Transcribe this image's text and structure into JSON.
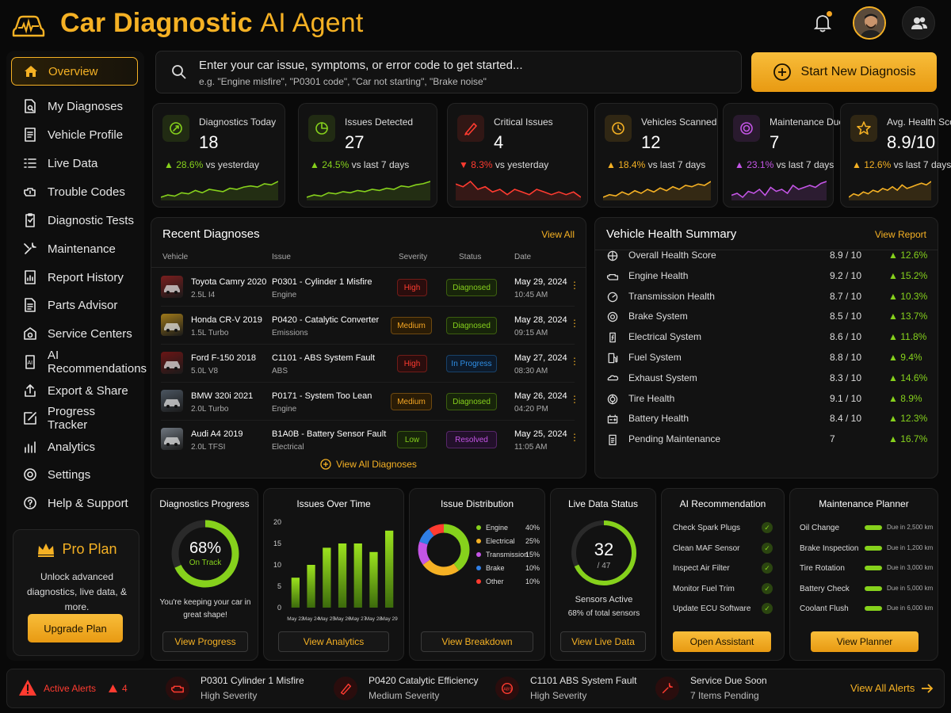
{
  "header": {
    "title_bold": "Car Diagnostic",
    "title_light": "AI Agent"
  },
  "sidebar": {
    "items": [
      {
        "label": "Overview",
        "icon": "home-icon",
        "active": true
      },
      {
        "label": "My Diagnoses",
        "icon": "document-search-icon"
      },
      {
        "label": "Vehicle Profile",
        "icon": "vehicle-profile-icon"
      },
      {
        "label": "Live Data",
        "icon": "list-icon"
      },
      {
        "label": "Trouble Codes",
        "icon": "engine-warning-icon"
      },
      {
        "label": "Diagnostic Tests",
        "icon": "test-clipboard-icon"
      },
      {
        "label": "Maintenance",
        "icon": "wrench-icon"
      },
      {
        "label": "Report History",
        "icon": "report-icon"
      },
      {
        "label": "Parts Advisor",
        "icon": "document-icon"
      },
      {
        "label": "Service Centers",
        "icon": "service-center-icon"
      },
      {
        "label": "AI Recommendations",
        "icon": "ai-icon"
      },
      {
        "label": "Export & Share",
        "icon": "share-icon"
      },
      {
        "label": "Progress Tracker",
        "icon": "edit-icon"
      },
      {
        "label": "Analytics",
        "icon": "analytics-icon"
      },
      {
        "label": "Settings",
        "icon": "gear-icon"
      },
      {
        "label": "Help & Support",
        "icon": "help-icon"
      }
    ],
    "pro": {
      "title": "Pro Plan",
      "text": "Unlock advanced diagnostics, live data, & more.",
      "button": "Upgrade Plan"
    }
  },
  "search": {
    "title": "Enter your car issue, symptoms, or error code to get started...",
    "example": "e.g. \"Engine misfire\", \"P0301 code\", \"Car not starting\", \"Brake noise\""
  },
  "start_button": "Start New Diagnosis",
  "stats": [
    {
      "label": "Diagnostics Today",
      "value": "18",
      "change": "28.6%",
      "dir": "up",
      "period": "vs yesterday",
      "color": "#86d11c",
      "icon": "diagnostics-icon"
    },
    {
      "label": "Issues Detected",
      "value": "27",
      "change": "24.5%",
      "dir": "up",
      "period": "vs last 7 days",
      "color": "#86d11c",
      "icon": "pie-icon"
    },
    {
      "label": "Critical Issues",
      "value": "4",
      "change": "8.3%",
      "dir": "down",
      "period": "vs yesterday",
      "color": "#ff3b30",
      "icon": "critical-icon"
    },
    {
      "label": "Vehicles Scanned",
      "value": "12",
      "change": "18.4%",
      "dir": "up",
      "period": "vs last 7 days",
      "color": "#f5b124",
      "icon": "clock-icon"
    },
    {
      "label": "Maintenance Due",
      "value": "7",
      "change": "23.1%",
      "dir": "up",
      "period": "vs last 7 days",
      "color": "#c455e6",
      "icon": "maintenance-icon"
    },
    {
      "label": "Avg. Health Score",
      "value": "8.9/10",
      "change": "12.6%",
      "dir": "up",
      "period": "vs last 7 days",
      "color": "#f5b124",
      "icon": "star-icon"
    }
  ],
  "recent": {
    "title": "Recent Diagnoses",
    "link": "View All",
    "headers": {
      "vehicle": "Vehicle",
      "issue": "Issue",
      "severity": "Severity",
      "status": "Status",
      "date": "Date"
    },
    "rows": [
      {
        "car": "Toyota Camry 2020",
        "engine": "2.5L I4",
        "code": "P0301 - Cylinder 1 Misfire",
        "system": "Engine",
        "severity": "High",
        "status": "Diagnosed",
        "date": "May 29, 2024",
        "time": "10:45 AM",
        "thumb": "#7a1e1e"
      },
      {
        "car": "Honda CR-V 2019",
        "engine": "1.5L Turbo",
        "code": "P0420 - Catalytic Converter",
        "system": "Emissions",
        "severity": "Medium",
        "status": "Diagnosed",
        "date": "May 28, 2024",
        "time": "09:15 AM",
        "thumb": "#a07a1a"
      },
      {
        "car": "Ford F-150 2018",
        "engine": "5.0L V8",
        "code": "C1101 - ABS System Fault",
        "system": "ABS",
        "severity": "High",
        "status": "In Progress",
        "date": "May 27, 2024",
        "time": "08:30 AM",
        "thumb": "#6a1515"
      },
      {
        "car": "BMW 320i 2021",
        "engine": "2.0L Turbo",
        "code": "P0171 - System Too Lean",
        "system": "Engine",
        "severity": "Medium",
        "status": "Diagnosed",
        "date": "May 26, 2024",
        "time": "04:20 PM",
        "thumb": "#4b5560"
      },
      {
        "car": "Audi A4 2019",
        "engine": "2.0L TFSI",
        "code": "B1A0B - Battery Sensor Fault",
        "system": "Electrical",
        "severity": "Low",
        "status": "Resolved",
        "date": "May 25, 2024",
        "time": "11:05 AM",
        "thumb": "#6f7780"
      }
    ],
    "footer": "View All Diagnoses"
  },
  "health": {
    "title": "Vehicle Health Summary",
    "link": "View Report",
    "rows": [
      {
        "label": "Overall Health Score",
        "score": "8.9 / 10",
        "change": "12.6%",
        "icon": "overall-health-icon"
      },
      {
        "label": "Engine Health",
        "score": "9.2 / 10",
        "change": "15.2%",
        "icon": "engine-icon"
      },
      {
        "label": "Transmission Health",
        "score": "8.7 / 10",
        "change": "10.3%",
        "icon": "transmission-icon"
      },
      {
        "label": "Brake System",
        "score": "8.5 / 10",
        "change": "13.7%",
        "icon": "brake-icon"
      },
      {
        "label": "Electrical System",
        "score": "8.6 / 10",
        "change": "11.8%",
        "icon": "electrical-icon"
      },
      {
        "label": "Fuel System",
        "score": "8.8 / 10",
        "change": "9.4%",
        "icon": "fuel-icon"
      },
      {
        "label": "Exhaust System",
        "score": "8.3 / 10",
        "change": "14.6%",
        "icon": "exhaust-icon"
      },
      {
        "label": "Tire Health",
        "score": "9.1 / 10",
        "change": "8.9%",
        "icon": "tire-icon"
      },
      {
        "label": "Battery Health",
        "score": "8.4 / 10",
        "change": "12.3%",
        "icon": "battery-icon"
      },
      {
        "label": "Pending Maintenance",
        "score": "7",
        "change": "16.7%",
        "icon": "pending-icon"
      }
    ]
  },
  "progress": {
    "title": "Diagnostics Progress",
    "percent": "68%",
    "value": 0.68,
    "status": "On Track",
    "message": "You're keeping your car in great shape!",
    "button": "View Progress"
  },
  "issues_over_time": {
    "title": "Issues Over Time",
    "button": "View Analytics"
  },
  "distribution": {
    "title": "Issue Distribution",
    "button": "View Breakdown",
    "items": [
      {
        "name": "Engine",
        "pct": "40%",
        "value": 40,
        "color": "#86d11c"
      },
      {
        "name": "Electrical",
        "pct": "25%",
        "value": 25,
        "color": "#f5b124"
      },
      {
        "name": "Transmission",
        "pct": "15%",
        "value": 15,
        "color": "#c455e6"
      },
      {
        "name": "Brake",
        "pct": "10%",
        "value": 10,
        "color": "#2f7fe6"
      },
      {
        "name": "Other",
        "pct": "10%",
        "value": 10,
        "color": "#ff3b30"
      }
    ]
  },
  "live_status": {
    "title": "Live Data Status",
    "active": "32",
    "total": "/ 47",
    "label": "Sensors Active",
    "sub": "68% of total sensors",
    "value": 0.68,
    "button": "View Live Data"
  },
  "ai_rec": {
    "title": "AI Recommendation",
    "items": [
      "Check Spark Plugs",
      "Clean MAF Sensor",
      "Inspect Air Filter",
      "Monitor Fuel Trim",
      "Update ECU Software"
    ],
    "button": "Open Assistant"
  },
  "planner": {
    "title": "Maintenance Planner",
    "items": [
      {
        "name": "Oil Change",
        "due": "Due in 2,500 km"
      },
      {
        "name": "Brake Inspection",
        "due": "Due in 1,200 km"
      },
      {
        "name": "Tire Rotation",
        "due": "Due in 3,000 km"
      },
      {
        "name": "Battery Check",
        "due": "Due in 5,000 km"
      },
      {
        "name": "Coolant Flush",
        "due": "Due in 6,000 km"
      }
    ],
    "button": "View Planner"
  },
  "alerts": {
    "label": "Active Alerts",
    "count": "4",
    "items": [
      {
        "title": "P0301  Cylinder 1 Misfire",
        "sub": "High Severity",
        "icon": "engine-alert-icon"
      },
      {
        "title": "P0420  Catalytic Efficiency",
        "sub": "Medium Severity",
        "icon": "catalytic-alert-icon"
      },
      {
        "title": "C1101  ABS System Fault",
        "sub": "High Severity",
        "icon": "abs-alert-icon"
      },
      {
        "title": "Service Due Soon",
        "sub": "7 Items Pending",
        "icon": "service-alert-icon"
      }
    ],
    "link": "View All Alerts"
  },
  "chart_data": {
    "type": "bar",
    "categories": [
      "May 23",
      "May 24",
      "May 25",
      "May 26",
      "May 27",
      "May 28",
      "May 29"
    ],
    "values": [
      7,
      10,
      14,
      15,
      15,
      13,
      18
    ],
    "title": "Issues Over Time",
    "ylim": [
      0,
      20
    ],
    "yticks": [
      0,
      5,
      10,
      15,
      20
    ]
  }
}
